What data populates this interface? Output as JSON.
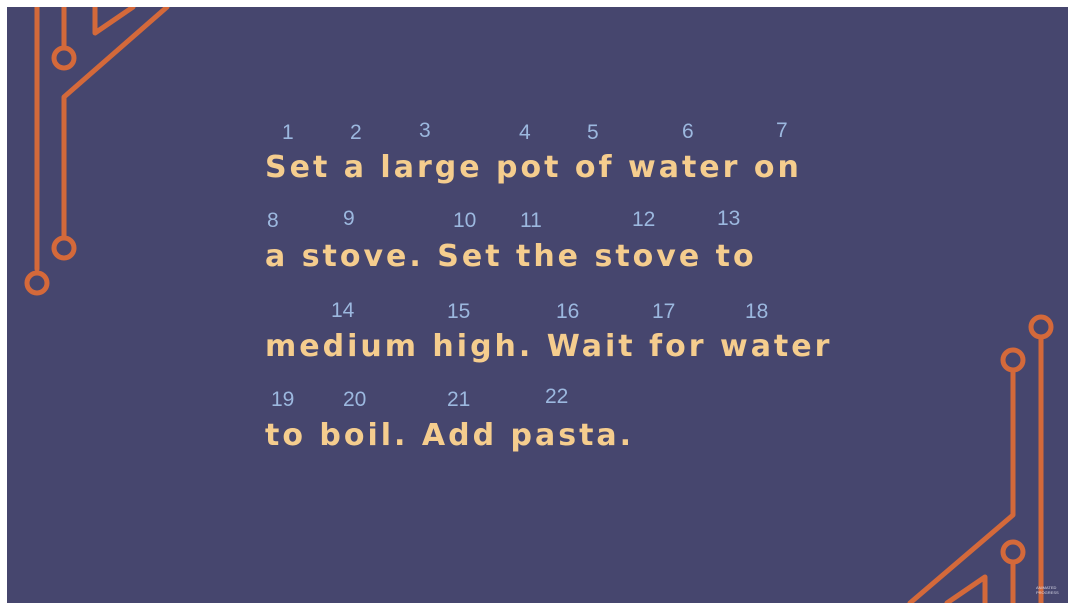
{
  "sentences": [
    {
      "text": "Set a large pot of water on",
      "numbers": [
        "1",
        "2",
        "3",
        "4",
        "5",
        "6",
        "7"
      ]
    },
    {
      "text": "a stove. Set the stove to",
      "numbers": [
        "8",
        "9",
        "10",
        "11",
        "12",
        "13"
      ]
    },
    {
      "text": "medium high. Wait for water",
      "numbers": [
        "14",
        "15",
        "16",
        "17",
        "18"
      ]
    },
    {
      "text": "to boil. Add pasta.",
      "numbers": [
        "19",
        "20",
        "21",
        "22"
      ]
    }
  ],
  "logo": {
    "line1": "ANIMATED",
    "line2": "PROGRESS"
  },
  "colors": {
    "background": "#46466e",
    "text": "#f5cd8e",
    "numbers": "#9cb8df",
    "circuit": "#d4693a"
  }
}
